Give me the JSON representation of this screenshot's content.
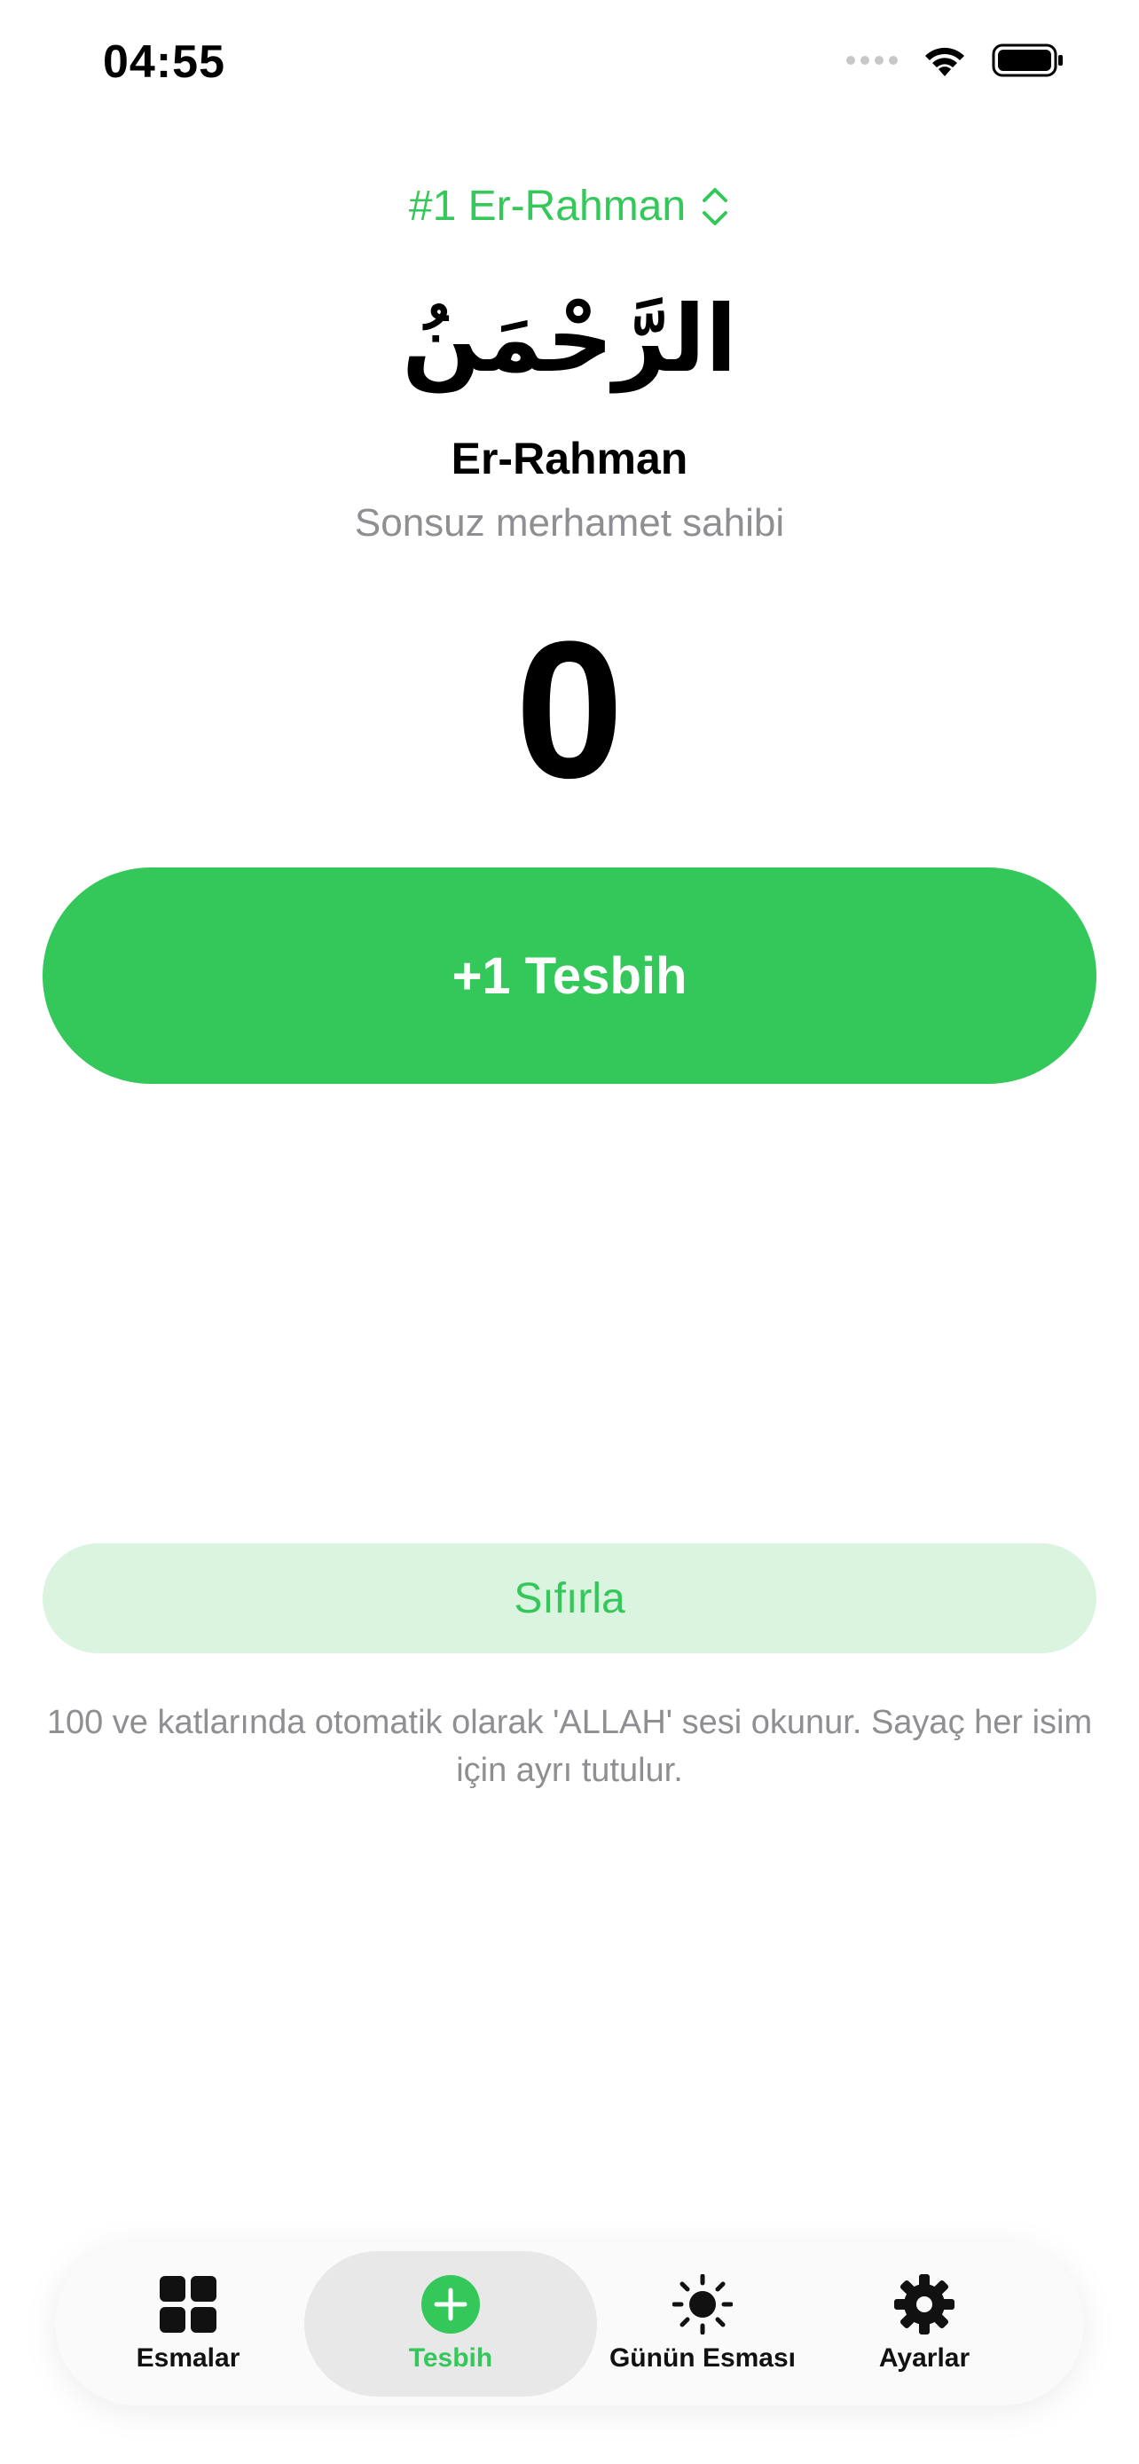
{
  "status_bar": {
    "time": "04:55"
  },
  "name_picker": {
    "label": "#1 Er-Rahman",
    "icon": "chevron-up-down-icon"
  },
  "name": {
    "arabic": "الرَّحْمَنُ",
    "latin": "Er-Rahman",
    "meaning": "Sonsuz merhamet sahibi"
  },
  "counter": {
    "value": "0"
  },
  "actions": {
    "tesbih_label": "+1 Tesbih",
    "reset_label": "Sıfırla"
  },
  "info": {
    "text": "100 ve katlarında otomatik olarak 'ALLAH' sesi okunur. Sayaç her isim için ayrı tutulur."
  },
  "tabs": [
    {
      "label": "Esmalar",
      "icon": "grid-icon"
    },
    {
      "label": "Tesbih",
      "icon": "plus-circle-icon",
      "active": true
    },
    {
      "label": "Günün Esması",
      "icon": "sun-icon"
    },
    {
      "label": "Ayarlar",
      "icon": "gear-icon"
    }
  ],
  "colors": {
    "accent": "#34c759",
    "accent_light": "#dbf4e0",
    "secondary_text": "#8e8e93"
  }
}
